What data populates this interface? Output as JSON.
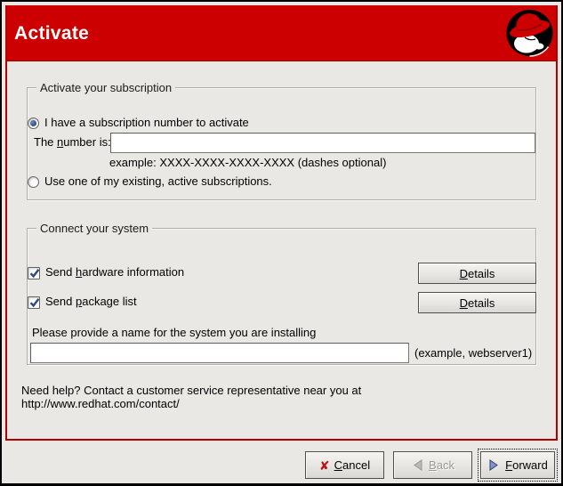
{
  "header": {
    "title": "Activate"
  },
  "subscription": {
    "legend": "Activate your subscription",
    "radio_number": {
      "label": "I have a subscription number to activate",
      "selected": true
    },
    "number_label": {
      "pre": "The ",
      "mnemonic": "n",
      "post": "umber is:"
    },
    "number_value": "",
    "example": "example: XXXX-XXXX-XXXX-XXXX (dashes optional)",
    "radio_existing": {
      "label": "Use one of my existing, active subscriptions.",
      "selected": false
    }
  },
  "connect": {
    "legend": "Connect your system",
    "hardware": {
      "pre": "Send ",
      "mnemonic": "h",
      "post": "ardware information",
      "checked": true
    },
    "package": {
      "pre": "Send ",
      "mnemonic": "p",
      "post": "ackage list",
      "checked": true
    },
    "details": {
      "mnemonic": "D",
      "post": "etails"
    },
    "name_prompt": "Please provide a name for the system you are installing",
    "name_value": "",
    "name_example": "(example, webserver1)"
  },
  "help": {
    "line1": "Need help? Contact a customer service representative near you at",
    "line2": "http://www.redhat.com/contact/"
  },
  "buttons": {
    "cancel": {
      "mnemonic": "C",
      "post": "ancel"
    },
    "back": {
      "mnemonic": "B",
      "post": "ack",
      "enabled": false
    },
    "forward": {
      "mnemonic": "F",
      "post": "orward",
      "focused": true
    }
  },
  "colors": {
    "banner_red": "#cc0000",
    "panel_border_red": "#b20000",
    "accent_blue": "#2c4a7c"
  }
}
